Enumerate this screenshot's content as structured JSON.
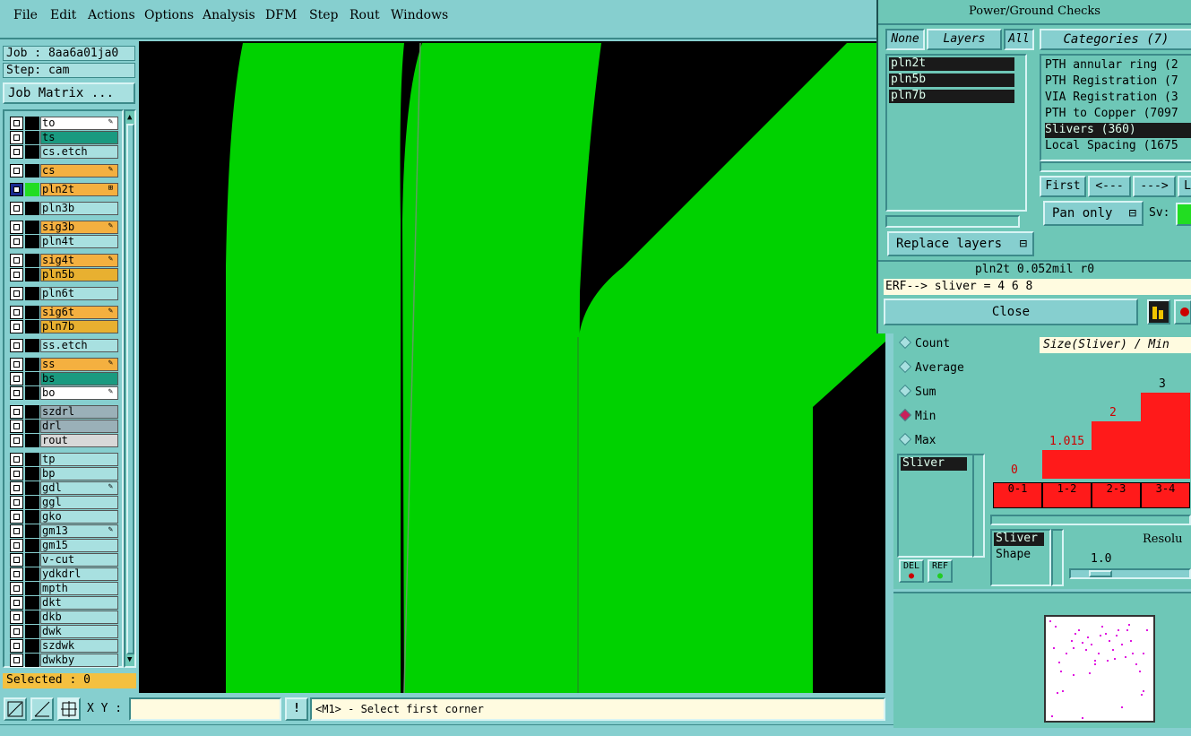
{
  "menubar": {
    "items": [
      "File",
      "Edit",
      "Actions",
      "Options",
      "Analysis",
      "DFM",
      "Step",
      "Rout",
      "Windows"
    ]
  },
  "left": {
    "job": "Job : 8aa6a01ja0",
    "step": "Step: cam",
    "job_matrix": "Job Matrix ...",
    "selected": "Selected : 0"
  },
  "layers": [
    {
      "name": "to",
      "color": "#ffffff",
      "mark": "pen"
    },
    {
      "name": "ts",
      "color": "#1a9a80",
      "mark": ""
    },
    {
      "name": "cs.etch",
      "color": "#a8e0e0",
      "mark": ""
    },
    {
      "name": "cs",
      "color": "#f4b040",
      "mark": "pen"
    },
    {
      "name": "pln2t",
      "color": "#f4b040",
      "mark": "box",
      "active": true
    },
    {
      "name": "pln3b",
      "color": "#a8e0e0",
      "mark": ""
    },
    {
      "name": "sig3b",
      "color": "#f4b040",
      "mark": "pen"
    },
    {
      "name": "pln4t",
      "color": "#a8e0e0",
      "mark": ""
    },
    {
      "name": "sig4t",
      "color": "#f4b040",
      "mark": "pen"
    },
    {
      "name": "pln5b",
      "color": "#e8b030",
      "mark": ""
    },
    {
      "name": "pln6t",
      "color": "#a8e0e0",
      "mark": ""
    },
    {
      "name": "sig6t",
      "color": "#f4b040",
      "mark": "pen"
    },
    {
      "name": "pln7b",
      "color": "#e8b030",
      "mark": ""
    },
    {
      "name": "ss.etch",
      "color": "#a8e0e0",
      "mark": ""
    },
    {
      "name": "ss",
      "color": "#f4b040",
      "mark": "pen"
    },
    {
      "name": "bs",
      "color": "#1a9a80",
      "mark": ""
    },
    {
      "name": "bo",
      "color": "#ffffff",
      "mark": "pen"
    },
    {
      "name": "szdrl",
      "color": "#9ab0b8",
      "mark": ""
    },
    {
      "name": "drl",
      "color": "#9ab0b8",
      "mark": ""
    },
    {
      "name": "rout",
      "color": "#d8d8d8",
      "mark": ""
    },
    {
      "name": "tp",
      "color": "#a8e0e0",
      "mark": ""
    },
    {
      "name": "bp",
      "color": "#a8e0e0",
      "mark": ""
    },
    {
      "name": "gdl",
      "color": "#a8e0e0",
      "mark": "pen"
    },
    {
      "name": "ggl",
      "color": "#a8e0e0",
      "mark": ""
    },
    {
      "name": "gko",
      "color": "#a8e0e0",
      "mark": ""
    },
    {
      "name": "gm13",
      "color": "#a8e0e0",
      "mark": "pen"
    },
    {
      "name": "gm15",
      "color": "#a8e0e0",
      "mark": ""
    },
    {
      "name": "v-cut",
      "color": "#a8e0e0",
      "mark": ""
    },
    {
      "name": "ydkdrl",
      "color": "#a8e0e0",
      "mark": ""
    },
    {
      "name": "mpth",
      "color": "#a8e0e0",
      "mark": ""
    },
    {
      "name": "dkt",
      "color": "#a8e0e0",
      "mark": ""
    },
    {
      "name": "dkb",
      "color": "#a8e0e0",
      "mark": ""
    },
    {
      "name": "dwk",
      "color": "#a8e0e0",
      "mark": ""
    },
    {
      "name": "szdwk",
      "color": "#a8e0e0",
      "mark": ""
    },
    {
      "name": "dwkby",
      "color": "#a8e0e0",
      "mark": ""
    }
  ],
  "bottom": {
    "xy_label": "X Y :",
    "xy_value": "",
    "warn": "!",
    "prompt": "<M1> - Select first corner"
  },
  "pg": {
    "title": "Power/Ground Checks",
    "none": "None",
    "layers": "Layers",
    "all": "All",
    "layer_list": [
      "pln2t",
      "pln5b",
      "pln7b"
    ],
    "categories_title": "Categories (7)",
    "categories": [
      "PTH annular ring (2",
      "PTH Registration (7",
      "VIA Registration (3",
      "PTH to Copper (7097",
      "Slivers (360)",
      "Local Spacing (1675"
    ],
    "selected_category": 4,
    "first": "First",
    "prev": "<---",
    "next": "--->",
    "last": "La",
    "pan_only": "Pan only",
    "sv": "Sv:",
    "replace_layers": "Replace layers",
    "info": "pln2t 0.052mil  r0",
    "erf": "ERF--> sliver = 4 6 8",
    "close": "Close"
  },
  "stats": {
    "radios": [
      "Count",
      "Average",
      "Sum",
      "Min",
      "Max"
    ],
    "selected_radio": "Min",
    "chart_title": "Size(Sliver) / Min",
    "attr_list": [
      "Sliver"
    ],
    "shape_list": [
      "Sliver",
      "Shape"
    ],
    "resolution_label": "Resolu",
    "resolution_value": "1.0",
    "del": "DEL",
    "ref": "REF"
  },
  "chart_data": {
    "type": "bar",
    "title": "Size(Sliver) / Min",
    "categories": [
      "0-1",
      "1-2",
      "2-3",
      "3-4"
    ],
    "values": [
      0,
      1.015,
      2,
      3
    ],
    "value_labels": [
      "0",
      "1.015",
      "2",
      "3"
    ]
  }
}
